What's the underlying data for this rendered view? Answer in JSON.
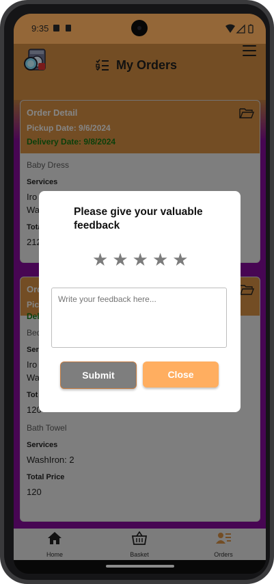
{
  "status_bar": {
    "time": "9:35"
  },
  "header": {
    "title": "My Orders"
  },
  "orders": [
    {
      "title": "Order Detail",
      "pickup": "Pickup Date: 9/6/2024",
      "delivery": "Delivery Date: 9/8/2024",
      "item": "Baby Dress",
      "services_label": "Services",
      "service_line1": "Iro",
      "service_line2": "Wa",
      "total_label": "Tota",
      "total_value": "212"
    },
    {
      "title": "Ord",
      "pickup": "Pick",
      "delivery": "Deli",
      "item": "Bed",
      "services_label": "Serv",
      "service_line1": "Iro",
      "service_line2": "Wa",
      "total_label": "Tot",
      "total_value": "120",
      "item2": "Bath Towel",
      "services_label2": "Services",
      "service2": "WashIron: 2",
      "total_label2": "Total Price",
      "total_value2": "120"
    }
  ],
  "dialog": {
    "title": "Please give your valuable feedback",
    "rating": 0,
    "stars": [
      "★",
      "★",
      "★",
      "★",
      "★"
    ],
    "placeholder": "Write your feedback here...",
    "submit_label": "Submit",
    "close_label": "Close"
  },
  "bottom_nav": [
    {
      "label": "Home",
      "icon": "home-icon"
    },
    {
      "label": "Basket",
      "icon": "basket-icon"
    },
    {
      "label": "Orders",
      "icon": "orders-icon",
      "active": true
    }
  ],
  "colors": {
    "status_bar": "#ffb261",
    "header": "#c6863f",
    "background": "#7b0b8f",
    "delivery_text": "#136d13",
    "submit": "#7e7e7e",
    "close": "#ffae60"
  }
}
